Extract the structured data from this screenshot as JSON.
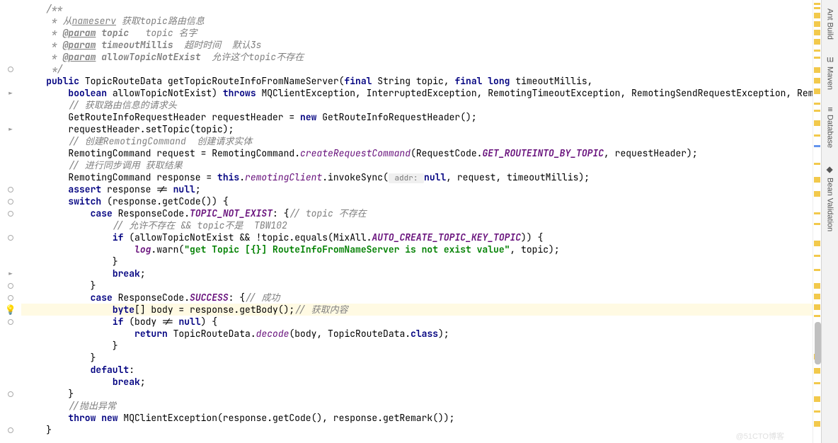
{
  "sidebar": {
    "tabs": [
      {
        "label": "Ant Build",
        "icon": "🐜"
      },
      {
        "label": "Maven",
        "icon": "m"
      },
      {
        "label": "Database",
        "icon": "≡"
      },
      {
        "label": "Bean Validation",
        "icon": "◆"
      }
    ]
  },
  "code": {
    "l1": "    /**",
    "l2a": "     * 从",
    "l2b": "nameserv",
    "l2c": " 获取topic路由信息",
    "l3a": "     * ",
    "l3b": "@param",
    "l3c": " topic",
    "l3d": "   topic 名字",
    "l4a": "     * ",
    "l4b": "@param",
    "l4c": " timeoutMillis",
    "l4d": "  超时时间  默认3s",
    "l5a": "     * ",
    "l5b": "@param",
    "l5c": " allowTopicNotExist",
    "l5d": "  允许这个topic不存在",
    "l6": "     */",
    "l7a": "    ",
    "l7b": "public",
    "l7c": " TopicRouteData getTopicRouteInfoFromNameServer(",
    "l7d": "final",
    "l7e": " String topic, ",
    "l7f": "final long",
    "l7g": " timeoutMillis,",
    "l8a": "        ",
    "l8b": "boolean",
    "l8c": " allowTopicNotExist) ",
    "l8d": "throws",
    "l8e": " MQClientException, InterruptedException, RemotingTimeoutException, RemotingSendRequestException, Remot",
    "l9a": "        ",
    "l9b": "// 获取路由信息的请求头",
    "l10a": "        GetRouteInfoRequestHeader requestHeader = ",
    "l10b": "new",
    "l10c": " GetRouteInfoRequestHeader();",
    "l11": "        requestHeader.setTopic(topic);",
    "l12a": "        ",
    "l12b": "// 创建RemotingCommand  创建请求实体",
    "l13a": "        RemotingCommand request = RemotingCommand.",
    "l13b": "createRequestCommand",
    "l13c": "(RequestCode.",
    "l13d": "GET_ROUTEINTO_BY_TOPIC",
    "l13e": ", requestHeader);",
    "l14a": "        ",
    "l14b": "// 进行同步调用 获取结果",
    "l15a": "        RemotingCommand response = ",
    "l15b": "this",
    "l15c": ".",
    "l15d": "remotingClient",
    "l15e": ".invokeSync(",
    "l15f": " addr: ",
    "l15g": "null",
    "l15h": ", request, timeoutMillis);",
    "l16a": "        ",
    "l16b": "assert",
    "l16c": " response != ",
    "l16d": "null",
    "l16e": ";",
    "l17a": "        ",
    "l17b": "switch",
    "l17c": " (response.getCode()) {",
    "l18a": "            ",
    "l18b": "case",
    "l18c": " ResponseCode.",
    "l18d": "TOPIC_NOT_EXIST",
    "l18e": ": {",
    "l18f": "// topic 不存在",
    "l19a": "                ",
    "l19b": "// 允许不存在 && topic不是  TBW102",
    "l20a": "                ",
    "l20b": "if",
    "l20c": " (allowTopicNotExist && !topic.equals(MixAll.",
    "l20d": "AUTO_CREATE_TOPIC_KEY_TOPIC",
    "l20e": ")) {",
    "l21a": "                    ",
    "l21b": "log",
    "l21c": ".warn(",
    "l21d": "\"get Topic [{}] RouteInfoFromNameServer is not exist value\"",
    "l21e": ", topic);",
    "l22": "                }",
    "l23a": "                ",
    "l23b": "break",
    "l23c": ";",
    "l24": "            }",
    "l25a": "            ",
    "l25b": "case",
    "l25c": " ResponseCode.",
    "l25d": "SUCCESS",
    "l25e": ": {",
    "l25f": "// 成功",
    "l26a": "                ",
    "l26b": "byte",
    "l26c": "[] body = response.getBody();",
    "l26d": "// 获取内容",
    "l27a": "                ",
    "l27b": "if",
    "l27c": " (body != ",
    "l27d": "null",
    "l27e": ") {",
    "l28a": "                    ",
    "l28b": "return",
    "l28c": " TopicRouteData.",
    "l28d": "decode",
    "l28e": "(body, TopicRouteData.",
    "l28f": "class",
    "l28g": ");",
    "l29": "                }",
    "l30": "            }",
    "l31a": "            ",
    "l31b": "default",
    "l31c": ":",
    "l32a": "                ",
    "l32b": "break",
    "l32c": ";",
    "l33": "        }",
    "l34a": "        ",
    "l34b": "//抛出异常",
    "l35a": "        ",
    "l35b": "throw new",
    "l35c": " MQClientException(response.getCode(), response.getRemark());",
    "l36": "    }"
  },
  "watermark": "@51CTO博客"
}
